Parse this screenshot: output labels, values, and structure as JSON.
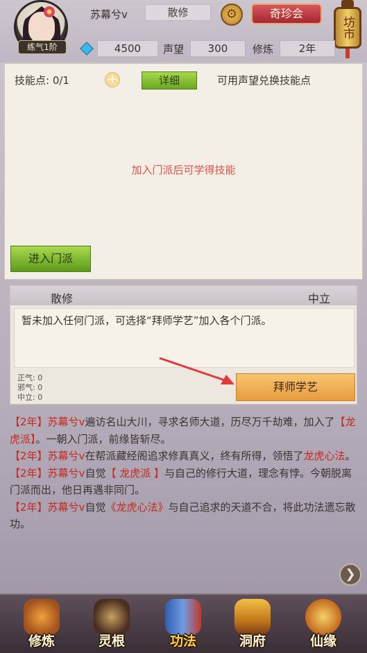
{
  "header": {
    "player_name": "苏幕兮v",
    "faction": "散修",
    "level_badge": "练气1阶",
    "treasure_button": "奇珍会",
    "market_label": "坊市",
    "currency_value": "4500",
    "reputation_label": "声望",
    "reputation_value": "300",
    "cultivation_label": "修炼",
    "cultivation_value": "2年"
  },
  "skills": {
    "points_label": "技能点: 0/1",
    "detail_button": "详细",
    "exchange_text": "可用声望兑换技能点",
    "join_hint": "加入门派后可学得技能",
    "enter_sect_button": "进入门派"
  },
  "sect": {
    "name": "散修",
    "alignment": "中立",
    "description": "暂未加入任何门派，可选择“拜师学艺”加入各个门派。",
    "stat_righteous": "正气: 0",
    "stat_evil": "邪气: 0",
    "stat_neutral": "中立: 0",
    "learn_button": "拜师学艺"
  },
  "log": [
    {
      "year": "【2年】",
      "name": "苏幕兮v",
      "pre": "遍访名山大川，寻求名师大道，历尽万千劫难，加入了",
      "hl": "【龙虎派】",
      "post": "。一朝入门派，前缘皆斩尽。"
    },
    {
      "year": "【2年】",
      "name": "苏幕兮v",
      "pre": "在帮派藏经阁追求修真真义，终有所得，领悟了",
      "hl": "龙虎心法",
      "post": "。"
    },
    {
      "year": "【2年】",
      "name": "苏幕兮v",
      "pre": "自觉",
      "hl": "【 龙虎派 】",
      "post": "与自己的修行大道，理念有悖。今朝脱离门派而出，他日再遇非同门。"
    },
    {
      "year": "【2年】",
      "name": "苏幕兮v",
      "pre": "自觉",
      "hl": "《龙虎心法》",
      "post": "与自己追求的天道不合，将此功法遗忘散功。"
    }
  ],
  "nav": {
    "items": [
      {
        "label": "修炼",
        "icon": "monk-icon"
      },
      {
        "label": "灵根",
        "icon": "spirit-root-icon"
      },
      {
        "label": "功法",
        "icon": "scripture-icon"
      },
      {
        "label": "洞府",
        "icon": "pagoda-icon"
      },
      {
        "label": "仙缘",
        "icon": "gourd-icon"
      }
    ],
    "active_index": 2
  },
  "colors": {
    "highlight_red": "#c5281f",
    "green_button": "#7cb32b",
    "orange_button": "#f0ae55",
    "treasure_red": "#c23a44"
  }
}
